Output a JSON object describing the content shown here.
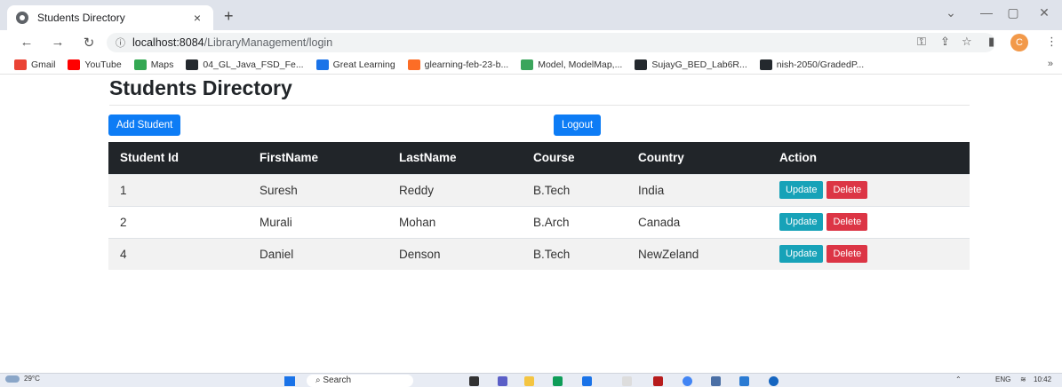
{
  "browser": {
    "tab_title": "Students Directory",
    "tab_close": "×",
    "new_tab": "+",
    "url_host": "localhost:8084",
    "url_path": "/LibraryManagement/login",
    "profile_initial": "C",
    "bookmarks": [
      {
        "label": "Gmail",
        "color": "#ea4335"
      },
      {
        "label": "YouTube",
        "color": "#ff0000"
      },
      {
        "label": "Maps",
        "color": "#34a853"
      },
      {
        "label": "04_GL_Java_FSD_Fe...",
        "color": "#24292e"
      },
      {
        "label": "Great Learning",
        "color": "#1a73e8"
      },
      {
        "label": "glearning-feb-23-b...",
        "color": "#fc6d26"
      },
      {
        "label": "Model, ModelMap,...",
        "color": "#3ba55c"
      },
      {
        "label": "SujayG_BED_Lab6R...",
        "color": "#24292e"
      },
      {
        "label": "nish-2050/GradedP...",
        "color": "#24292e"
      }
    ],
    "bookmarks_more": "»"
  },
  "page": {
    "title": "Students Directory",
    "add_button": "Add Student",
    "logout_button": "Logout",
    "columns": [
      "Student Id",
      "FirstName",
      "LastName",
      "Course",
      "Country",
      "Action"
    ],
    "rows": [
      {
        "id": "1",
        "first": "Suresh",
        "last": "Reddy",
        "course": "B.Tech",
        "country": "India"
      },
      {
        "id": "2",
        "first": "Murali",
        "last": "Mohan",
        "course": "B.Arch",
        "country": "Canada"
      },
      {
        "id": "4",
        "first": "Daniel",
        "last": "Denson",
        "course": "B.Tech",
        "country": "NewZeland"
      }
    ],
    "update_label": "Update",
    "delete_label": "Delete"
  },
  "taskbar": {
    "temperature": "29°C",
    "search_placeholder": "Search",
    "lang": "ENG",
    "time": "10:42"
  },
  "colors": {
    "primary": "#0d7cf5",
    "update": "#17a2b8",
    "delete": "#dc3545",
    "table_header": "#212529"
  }
}
